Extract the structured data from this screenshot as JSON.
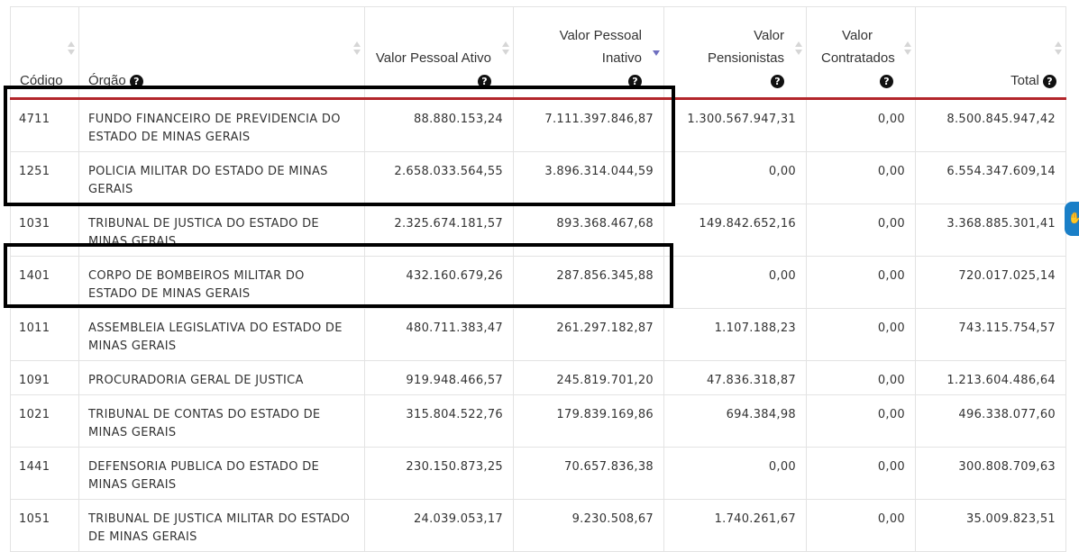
{
  "columns": [
    {
      "label": "Código"
    },
    {
      "label": "Órgão"
    },
    {
      "label": "Valor Pessoal Ativo"
    },
    {
      "label": "Valor Pessoal Inativo"
    },
    {
      "label": "Valor Pensionistas"
    },
    {
      "label": "Valor Contratados"
    },
    {
      "label": "Total"
    }
  ],
  "help_glyph": "?",
  "rows": [
    {
      "codigo": "4711",
      "orgao": "FUNDO FINANCEIRO DE PREVIDENCIA DO ESTADO DE MINAS GERAIS",
      "ativo": "88.880.153,24",
      "inativo": "7.111.397.846,87",
      "pensionistas": "1.300.567.947,31",
      "contratados": "0,00",
      "total": "8.500.845.947,42"
    },
    {
      "codigo": "1251",
      "orgao": "POLICIA MILITAR DO ESTADO DE MINAS GERAIS",
      "ativo": "2.658.033.564,55",
      "inativo": "3.896.314.044,59",
      "pensionistas": "0,00",
      "contratados": "0,00",
      "total": "6.554.347.609,14"
    },
    {
      "codigo": "1031",
      "orgao": "TRIBUNAL DE JUSTICA DO ESTADO DE MINAS GERAIS",
      "ativo": "2.325.674.181,57",
      "inativo": "893.368.467,68",
      "pensionistas": "149.842.652,16",
      "contratados": "0,00",
      "total": "3.368.885.301,41"
    },
    {
      "codigo": "1401",
      "orgao": "CORPO DE BOMBEIROS MILITAR DO ESTADO DE MINAS GERAIS",
      "ativo": "432.160.679,26",
      "inativo": "287.856.345,88",
      "pensionistas": "0,00",
      "contratados": "0,00",
      "total": "720.017.025,14"
    },
    {
      "codigo": "1011",
      "orgao": "ASSEMBLEIA LEGISLATIVA DO ESTADO DE MINAS GERAIS",
      "ativo": "480.711.383,47",
      "inativo": "261.297.182,87",
      "pensionistas": "1.107.188,23",
      "contratados": "0,00",
      "total": "743.115.754,57"
    },
    {
      "codigo": "1091",
      "orgao": "PROCURADORIA GERAL DE JUSTICA",
      "ativo": "919.948.466,57",
      "inativo": "245.819.701,20",
      "pensionistas": "47.836.318,87",
      "contratados": "0,00",
      "total": "1.213.604.486,64"
    },
    {
      "codigo": "1021",
      "orgao": "TRIBUNAL DE CONTAS DO ESTADO DE MINAS GERAIS",
      "ativo": "315.804.522,76",
      "inativo": "179.839.169,86",
      "pensionistas": "694.384,98",
      "contratados": "0,00",
      "total": "496.338.077,60"
    },
    {
      "codigo": "1441",
      "orgao": "DEFENSORIA PUBLICA DO ESTADO DE MINAS GERAIS",
      "ativo": "230.150.873,25",
      "inativo": "70.657.836,38",
      "pensionistas": "0,00",
      "contratados": "0,00",
      "total": "300.808.709,63"
    },
    {
      "codigo": "1051",
      "orgao": "TRIBUNAL DE JUSTICA MILITAR DO ESTADO DE MINAS GERAIS",
      "ativo": "24.039.053,17",
      "inativo": "9.230.508,67",
      "pensionistas": "1.740.261,67",
      "contratados": "0,00",
      "total": "35.009.823,51"
    }
  ],
  "colors": {
    "header_rule": "#b3262b",
    "sort_active": "#6f6fc0",
    "side_tab": "#1a7fc7"
  }
}
